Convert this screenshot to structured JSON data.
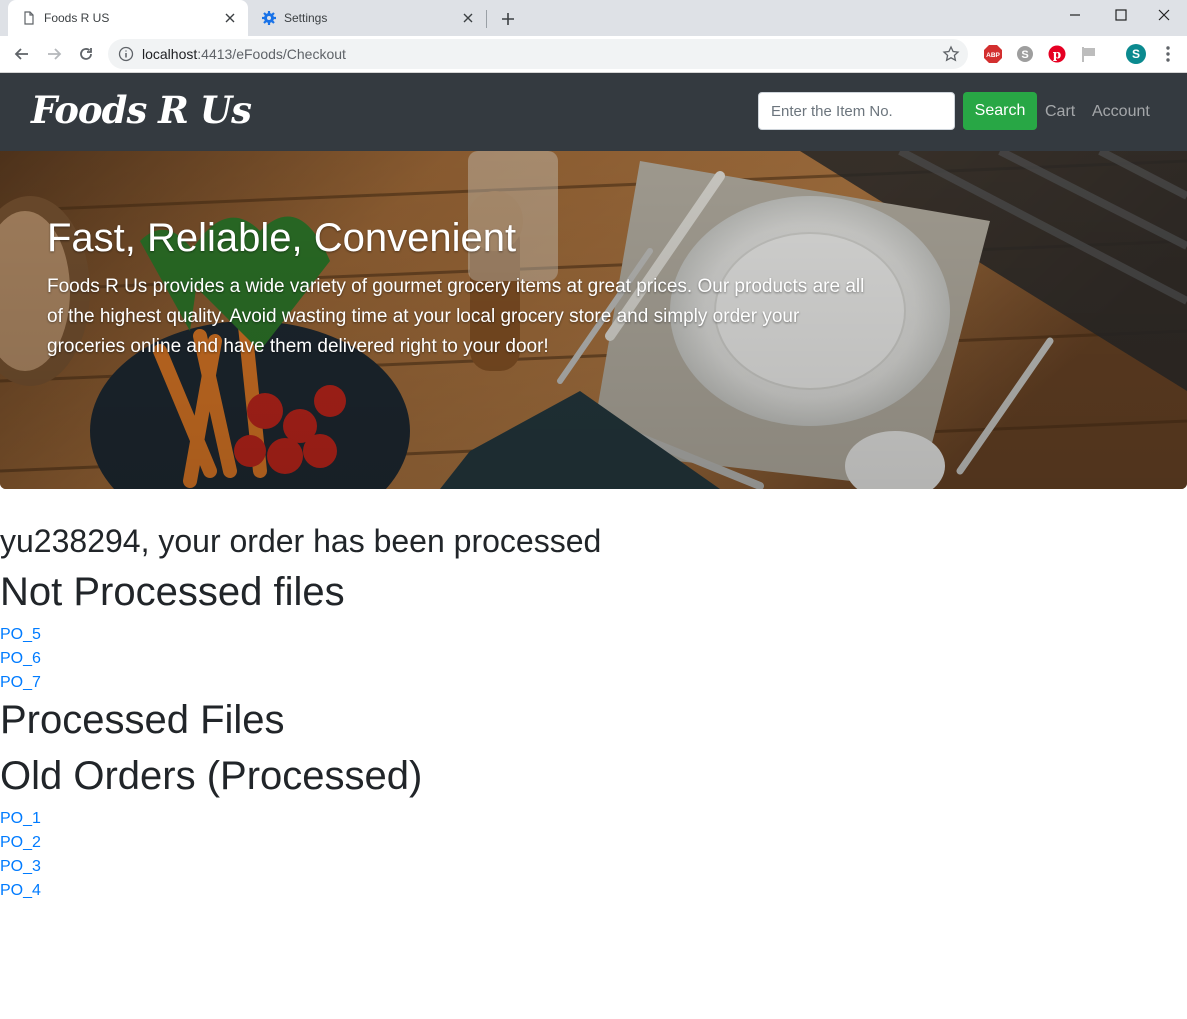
{
  "browser": {
    "tabs": [
      {
        "title": "Foods R US",
        "icon": "page-icon",
        "active": true
      },
      {
        "title": "Settings",
        "icon": "gear-icon",
        "active": false
      }
    ],
    "url_host": "localhost",
    "url_rest": ":4413/eFoods/Checkout",
    "extensions": [
      "adblock-icon",
      "skype-icon",
      "pinterest-icon",
      "flag-icon"
    ],
    "profile_initial": "S"
  },
  "site": {
    "brand": "Foods R Us",
    "search_placeholder": "Enter the Item No.",
    "search_label": "Search",
    "cart_label": "Cart",
    "account_label": "Account",
    "colors": {
      "navbar": "#343a40",
      "search_button": "#28a745",
      "link": "#007bff"
    }
  },
  "hero": {
    "title": "Fast, Reliable, Convenient",
    "text": "Foods R Us provides a wide variety of gourmet grocery items at great prices. Our products are all of the highest quality. Avoid wasting time at your local grocery store and simply order your groceries online and have them delivered right to your door!"
  },
  "main": {
    "confirmation": "yu238294, your order has been processed",
    "not_processed_heading": "Not Processed files",
    "not_processed": [
      "PO_5",
      "PO_6",
      "PO_7"
    ],
    "processed_heading": "Processed Files",
    "old_orders_heading": "Old Orders (Processed)",
    "old_orders": [
      "PO_1",
      "PO_2",
      "PO_3",
      "PO_4"
    ]
  }
}
